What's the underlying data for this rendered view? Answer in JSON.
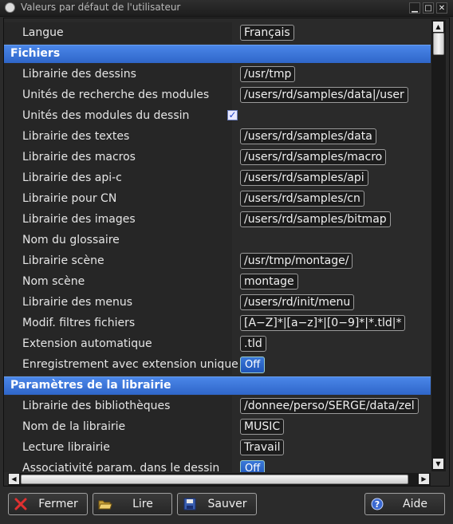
{
  "window": {
    "title": "Valeurs par défaut de l'utilisateur"
  },
  "rows": [
    {
      "label": "Langue",
      "value": "Français",
      "kind": "box"
    },
    {
      "section": "Fichiers"
    },
    {
      "label": "Librairie des dessins",
      "value": "/usr/tmp",
      "kind": "box"
    },
    {
      "label": "Unités de recherche des modules",
      "value": "/users/rd/samples/data|/user",
      "kind": "box"
    },
    {
      "label": "Unités des modules du dessin",
      "checked": true,
      "kind": "check"
    },
    {
      "label": "Librairie des textes",
      "value": "/users/rd/samples/data",
      "kind": "box"
    },
    {
      "label": "Librairie des macros",
      "value": "/users/rd/samples/macro",
      "kind": "box"
    },
    {
      "label": "Librairie des api-c",
      "value": "/users/rd/samples/api",
      "kind": "box"
    },
    {
      "label": "Librairie pour CN",
      "value": "/users/rd/samples/cn",
      "kind": "box"
    },
    {
      "label": "Librairie des images",
      "value": "/users/rd/samples/bitmap",
      "kind": "box"
    },
    {
      "label": "Nom du glossaire",
      "kind": "none"
    },
    {
      "label": "Librairie scène",
      "value": "/usr/tmp/montage/",
      "kind": "box"
    },
    {
      "label": "Nom scène",
      "value": "montage",
      "kind": "box"
    },
    {
      "label": "Librairie des menus",
      "value": "/users/rd/init/menu",
      "kind": "box"
    },
    {
      "label": "Modif. filtres fichiers",
      "value": "[A−Z]*|[a−z]*|[0−9]*|*.tld|*",
      "kind": "box"
    },
    {
      "label": "Extension automatique",
      "value": ".tld",
      "kind": "box"
    },
    {
      "label": "Enregistrement avec extension unique",
      "value": "Off",
      "kind": "toggle"
    },
    {
      "section": "Paramètres de la librairie"
    },
    {
      "label": "Librairie des bibliothèques",
      "value": "/donnee/perso/SERGE/data/zel",
      "kind": "box"
    },
    {
      "label": "Nom de la librairie",
      "value": "MUSIC",
      "kind": "box"
    },
    {
      "label": "Lecture librairie",
      "value": "Travail",
      "kind": "box"
    },
    {
      "label": "Associativité param. dans le dessin",
      "value": "Off",
      "kind": "toggle"
    }
  ],
  "buttons": {
    "close": "Fermer",
    "read": "Lire",
    "save": "Sauver",
    "help": "Aide"
  },
  "colors": {
    "section_blue": "#3a76dc",
    "toggle_blue": "#2a63c8",
    "close_icon": "#e03030"
  },
  "icons": [
    "close-icon",
    "folder-open-icon",
    "floppy-disk-icon",
    "help-icon",
    "checkmark-icon",
    "arrow-up-icon",
    "arrow-down-icon",
    "arrow-left-icon",
    "arrow-right-icon"
  ]
}
